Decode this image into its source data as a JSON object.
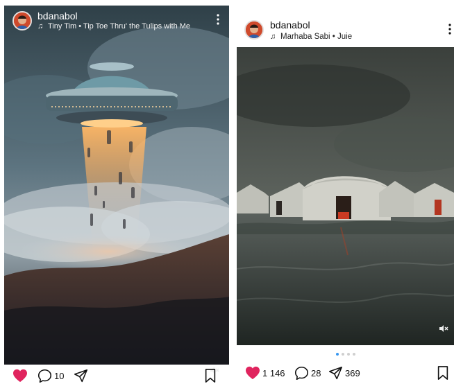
{
  "posts": [
    {
      "username": "bdanabol",
      "music": "Tiny Tim • Tip Toe Thru' the Tulips with Me",
      "liked": true,
      "comments": "10",
      "icons": [
        "music-note-icon",
        "more-icon",
        "mute-icon",
        "heart-filled-icon",
        "comment-icon",
        "share-icon",
        "bookmark-icon"
      ]
    },
    {
      "username": "bdanabol",
      "music": "Marhaba Sabi • Juie",
      "liked": true,
      "likes": "1 146",
      "comments": "28",
      "shares": "369",
      "carousel_pages": 4,
      "carousel_active": 1,
      "icons": [
        "music-note-icon",
        "more-icon",
        "mute-icon",
        "heart-filled-icon",
        "comment-icon",
        "share-icon",
        "bookmark-icon"
      ]
    }
  ],
  "colors": {
    "like_red": "#e0245e",
    "carousel_active": "#3897f0"
  }
}
